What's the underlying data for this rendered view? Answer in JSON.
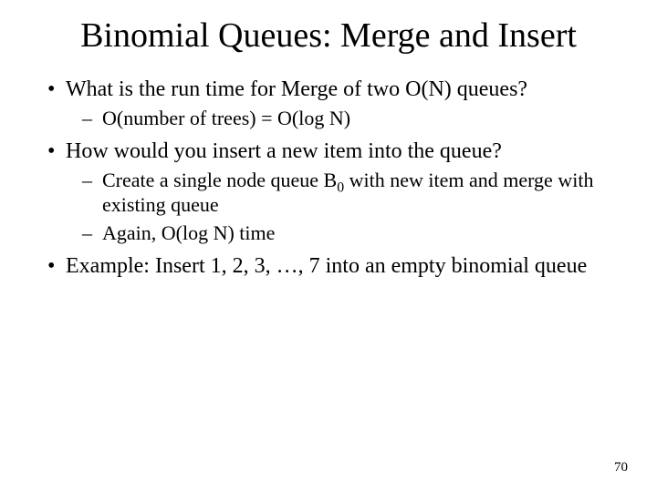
{
  "title": "Binomial Queues: Merge and Insert",
  "bullets": {
    "b1": "What is the run time for Merge of two O(N) queues?",
    "b1_sub1": "O(number of trees) = O(log N)",
    "b2": "How would you insert a new item into the queue?",
    "b2_sub1_pre": "Create a single node queue B",
    "b2_sub1_sub": "0",
    "b2_sub1_post": " with new item and merge with existing queue",
    "b2_sub2": "Again, O(log N) time",
    "b3": "Example: Insert 1, 2, 3, …, 7 into an empty binomial queue"
  },
  "pagenum": "70"
}
